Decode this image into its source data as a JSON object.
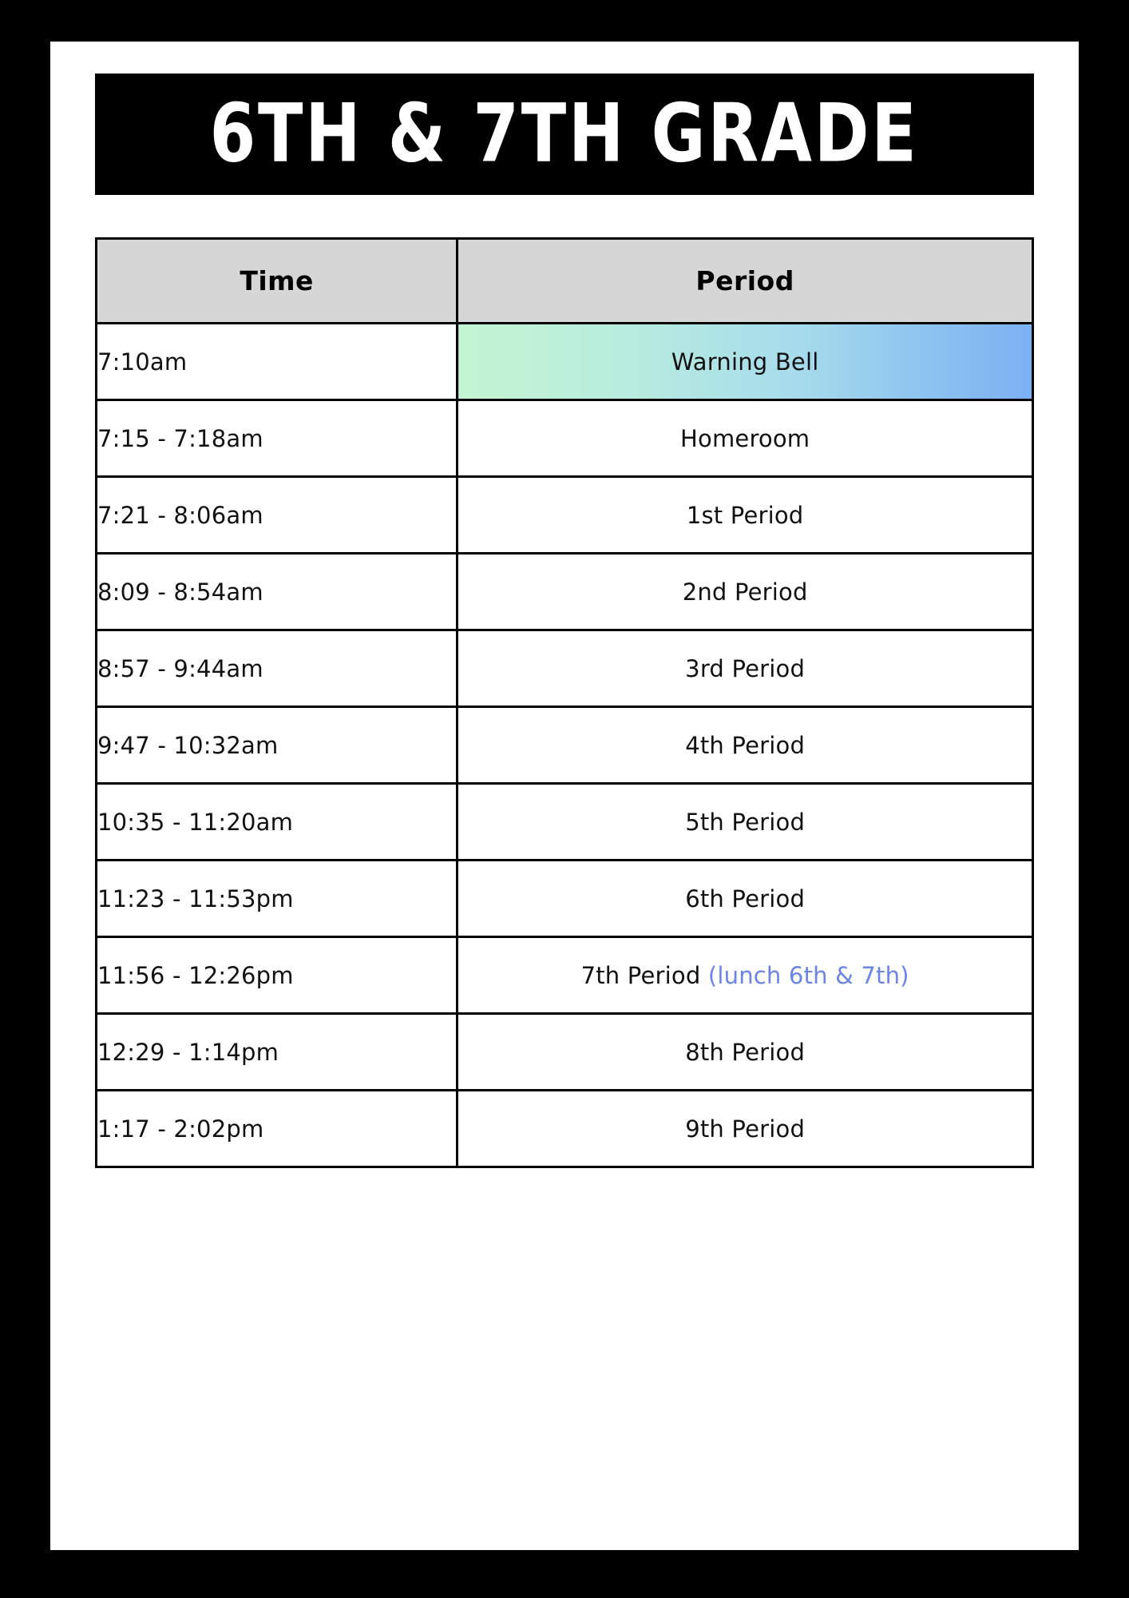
{
  "poster": {
    "title": "6th & 7th Grade",
    "accent_gradient_from": "#c4f5d2",
    "accent_gradient_to": "#7cb0f2",
    "lunch_note_color": "#6b84e8",
    "header_row_color": "#d6d6d6"
  },
  "table": {
    "columns": [
      {
        "key": "time",
        "label": "Time"
      },
      {
        "key": "period",
        "label": "Period"
      }
    ],
    "rows": [
      {
        "time": "7:10am",
        "period": "Warning Bell",
        "note": "",
        "highlight": true
      },
      {
        "time": "7:15 - 7:18am",
        "period": "Homeroom",
        "note": "",
        "highlight": false
      },
      {
        "time": "7:21 - 8:06am",
        "period": "1st Period",
        "note": "",
        "highlight": false
      },
      {
        "time": "8:09 - 8:54am",
        "period": "2nd Period",
        "note": "",
        "highlight": false
      },
      {
        "time": "8:57 - 9:44am",
        "period": "3rd Period",
        "note": "",
        "highlight": false
      },
      {
        "time": "9:47 - 10:32am",
        "period": "4th Period",
        "note": "",
        "highlight": false
      },
      {
        "time": "10:35 - 11:20am",
        "period": "5th Period",
        "note": "",
        "highlight": false
      },
      {
        "time": "11:23 - 11:53pm",
        "period": "6th Period",
        "note": "",
        "highlight": false
      },
      {
        "time": "11:56 - 12:26pm",
        "period": "7th Period",
        "note": "(lunch 6th & 7th)",
        "highlight": false
      },
      {
        "time": "12:29 - 1:14pm",
        "period": "8th Period",
        "note": "",
        "highlight": false
      },
      {
        "time": "1:17 - 2:02pm",
        "period": "9th Period",
        "note": "",
        "highlight": false
      }
    ]
  }
}
